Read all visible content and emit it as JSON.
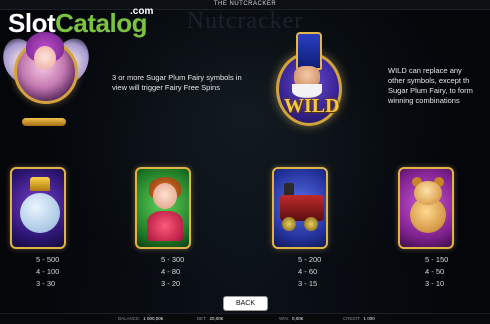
{
  "window": {
    "title": "THE NUTCRACKER"
  },
  "watermark": {
    "game_title": "Nutcracker",
    "logo_slot": "Slot",
    "logo_catalog": "Catalog",
    "logo_com": ".com"
  },
  "features": {
    "fairy": {
      "description": "3 or more Sugar Plum Fairy symbols in view will trigger Fairy Free Spins"
    },
    "wild": {
      "label": "WILD",
      "description_lines": [
        "WILD can replace any",
        "other symbols, except th",
        "Sugar Plum Fairy, to form",
        "winning combinations"
      ]
    }
  },
  "paytable": [
    {
      "symbol": "mouse-king",
      "rows": [
        "5 - 500",
        "4 - 100",
        "3 - 30"
      ]
    },
    {
      "symbol": "clara",
      "rows": [
        "5 - 300",
        "4 - 80",
        "3 - 20"
      ]
    },
    {
      "symbol": "toy-train",
      "rows": [
        "5 - 200",
        "4 - 60",
        "3 - 15"
      ]
    },
    {
      "symbol": "teddy-bear",
      "rows": [
        "5 - 150",
        "4 - 50",
        "3 - 10"
      ]
    }
  ],
  "back_button": {
    "label": "BACK"
  },
  "status": {
    "balance_label": "BALANCE:",
    "balance_value": "1 000,00€",
    "bet_label": "BET:",
    "bet_value": "20,00€",
    "win_label": "WIN:",
    "win_value": "0,00€",
    "credit_label": "CREDIT:",
    "credit_value": "1 000"
  },
  "colors": {
    "frame_gold": "#e0b347",
    "logo_green": "#7cc242",
    "background": "#04060a"
  }
}
